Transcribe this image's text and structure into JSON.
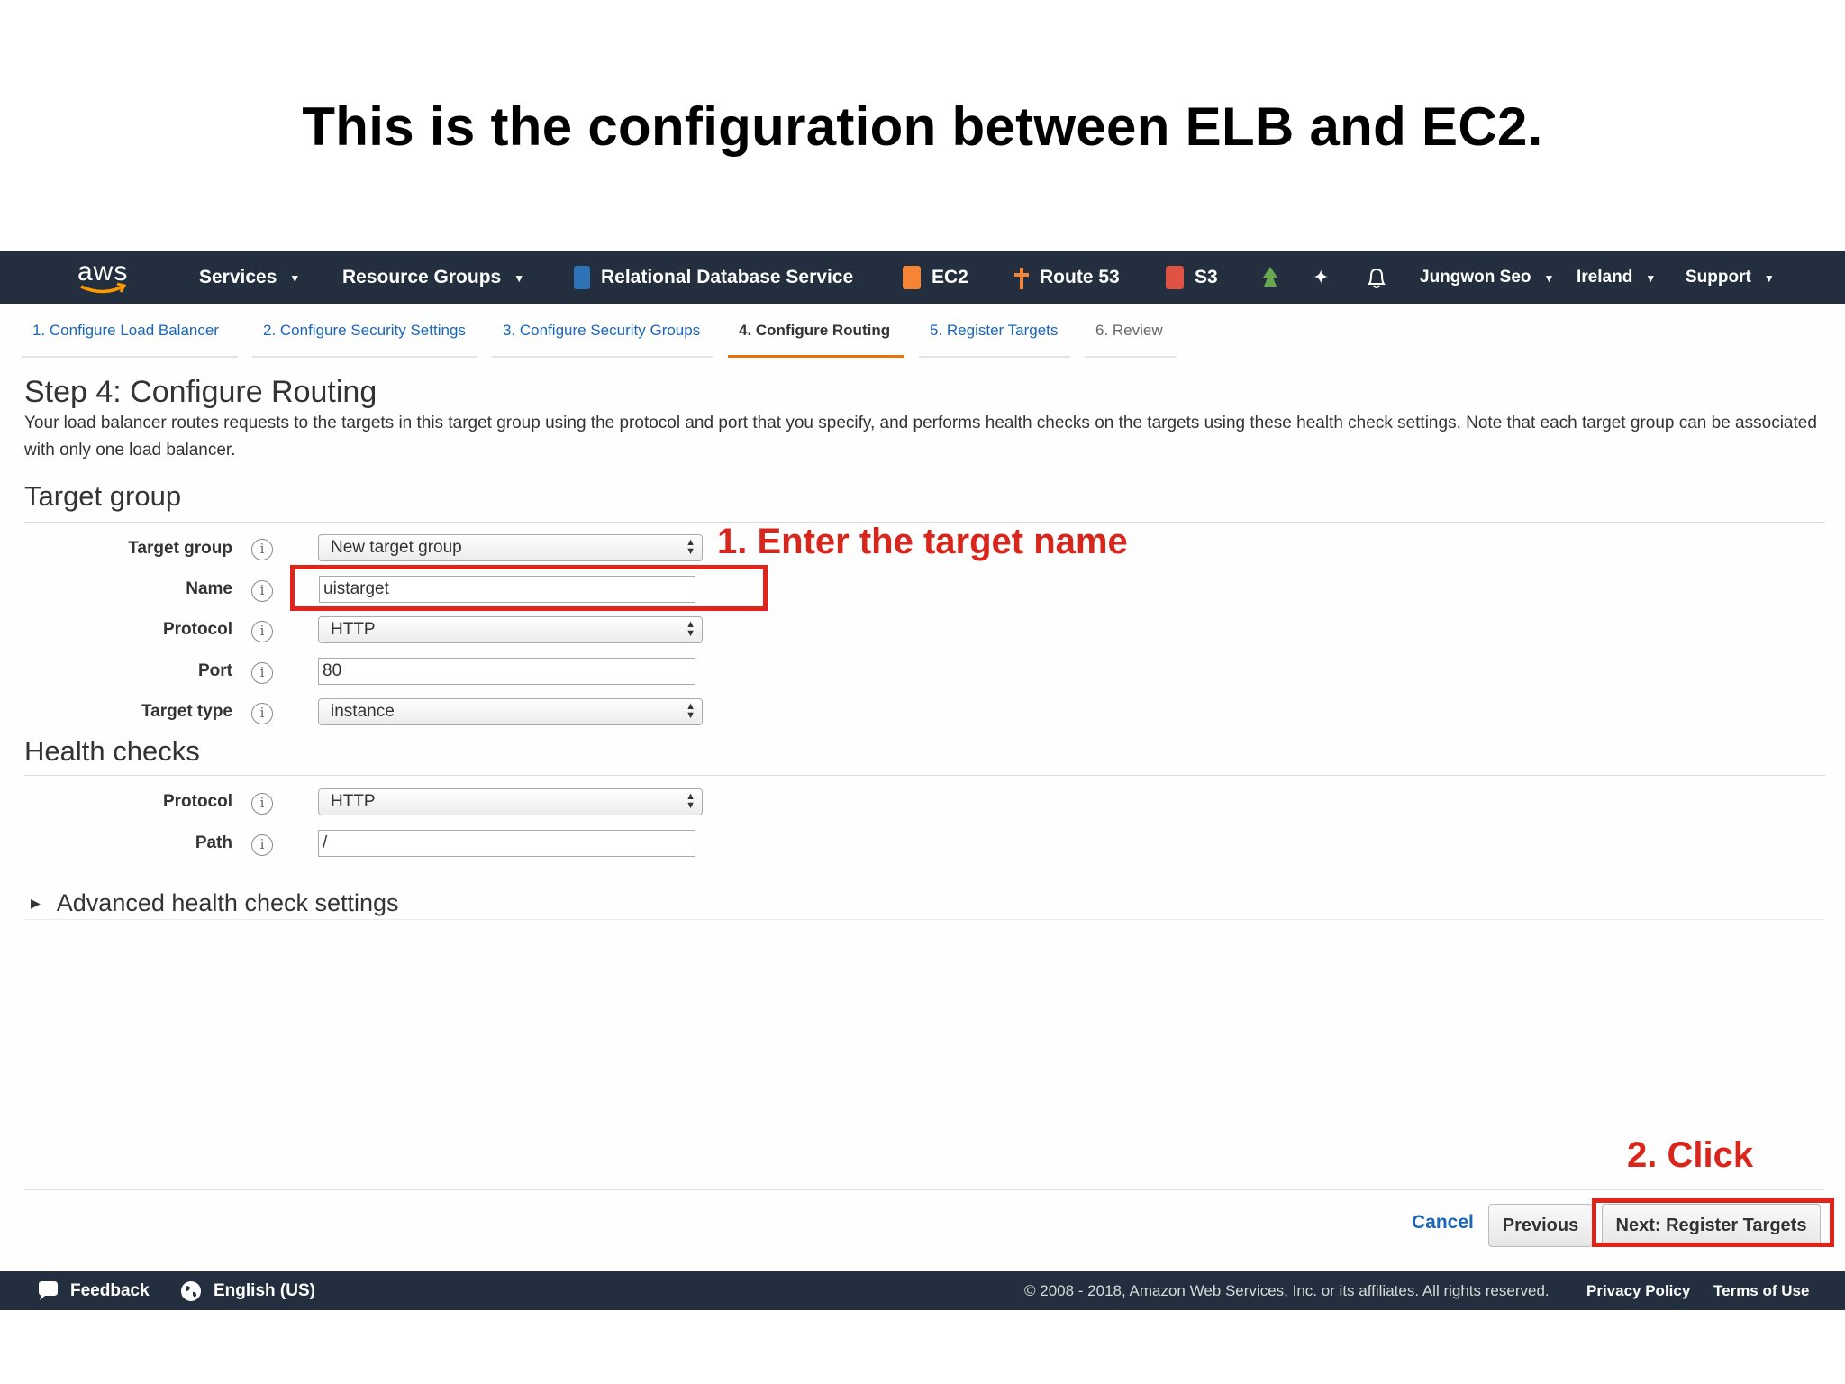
{
  "slide": {
    "title": "This is the configuration between ELB and EC2.",
    "annotation_1": "1. Enter the target name",
    "annotation_2": "2. Click"
  },
  "topnav": {
    "logo": "aws",
    "services": "Services",
    "resource_groups": "Resource Groups",
    "shortcuts": [
      {
        "label": "Relational Database Service",
        "icon": "rds-icon",
        "color": "#2e73b8"
      },
      {
        "label": "EC2",
        "icon": "ec2-icon",
        "color": "#f58534"
      },
      {
        "label": "Route 53",
        "icon": "route53-icon",
        "color": "#f58534"
      },
      {
        "label": "S3",
        "icon": "s3-icon",
        "color": "#e05243"
      }
    ],
    "user": "Jungwon Seo",
    "region": "Ireland",
    "support": "Support"
  },
  "wizard_tabs": [
    "1. Configure Load Balancer",
    "2. Configure Security Settings",
    "3. Configure Security Groups",
    "4. Configure Routing",
    "5. Register Targets",
    "6. Review"
  ],
  "step": {
    "title": "Step 4: Configure Routing",
    "description": "Your load balancer routes requests to the targets in this target group using the protocol and port that you specify, and performs health checks on the targets using these health check settings. Note that each target group can be associated with only one load balancer."
  },
  "target_group": {
    "heading": "Target group",
    "target_group_label": "Target group",
    "target_group_value": "New target group",
    "name_label": "Name",
    "name_value": "uistarget",
    "protocol_label": "Protocol",
    "protocol_value": "HTTP",
    "port_label": "Port",
    "port_value": "80",
    "target_type_label": "Target type",
    "target_type_value": "instance"
  },
  "health_checks": {
    "heading": "Health checks",
    "protocol_label": "Protocol",
    "protocol_value": "HTTP",
    "path_label": "Path",
    "path_value": "/",
    "advanced": "Advanced health check settings"
  },
  "actions": {
    "cancel": "Cancel",
    "previous": "Previous",
    "next": "Next: Register Targets"
  },
  "footer": {
    "feedback": "Feedback",
    "language": "English (US)",
    "copyright": "© 2008 - 2018, Amazon Web Services, Inc. or its affiliates. All rights reserved.",
    "privacy": "Privacy Policy",
    "terms": "Terms of Use"
  },
  "colors": {
    "nav_bg": "#232f3e",
    "accent_orange": "#ec7211",
    "link_blue": "#1a66b8",
    "annotation_red": "#e0241b"
  }
}
